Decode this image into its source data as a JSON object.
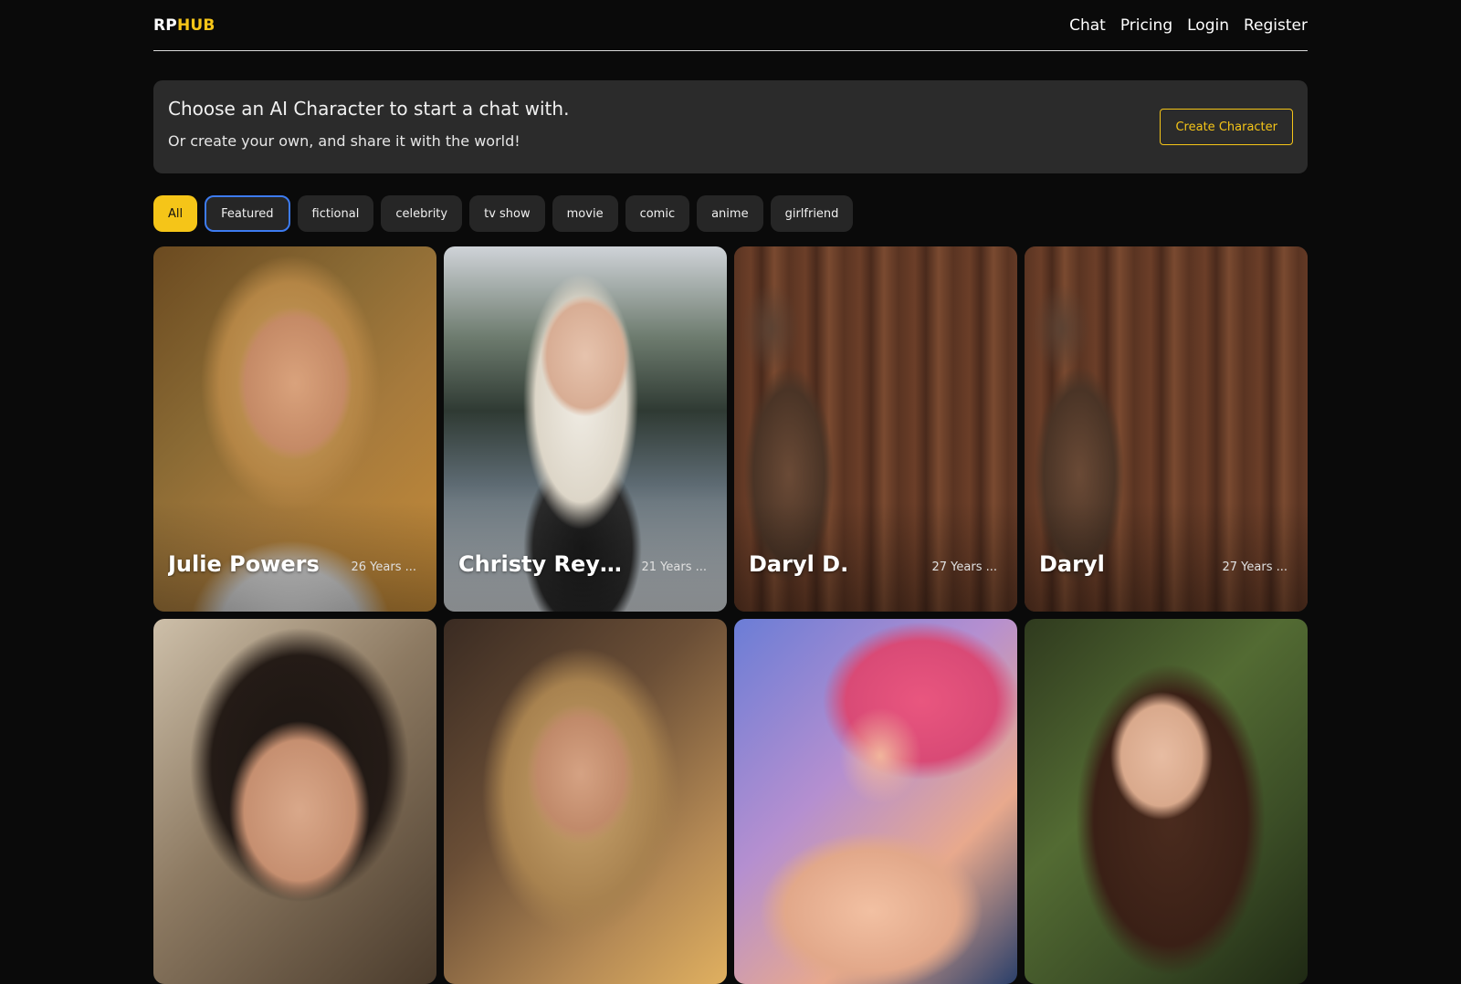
{
  "brand": {
    "part1": "RP",
    "part2": "HUB"
  },
  "nav": {
    "chat": "Chat",
    "pricing": "Pricing",
    "login": "Login",
    "register": "Register"
  },
  "hero": {
    "title": "Choose an AI Character to start a chat with.",
    "subtitle": "Or create your own, and share it with the world!",
    "create_button": "Create Character"
  },
  "filters": [
    "All",
    "Featured",
    "fictional",
    "celebrity",
    "tv show",
    "movie",
    "comic",
    "anime",
    "girlfriend"
  ],
  "active_filter": "All",
  "characters": [
    {
      "name": "Julie Powers",
      "age": "26 Years ..."
    },
    {
      "name": "Christy Reynol...",
      "age": "21 Years ..."
    },
    {
      "name": "Daryl D.",
      "age": "27 Years ..."
    },
    {
      "name": "Daryl",
      "age": "27 Years ..."
    },
    {
      "name": "",
      "age": ""
    },
    {
      "name": "",
      "age": ""
    },
    {
      "name": "",
      "age": ""
    },
    {
      "name": "",
      "age": ""
    }
  ],
  "colors": {
    "accent": "#f5c518",
    "background": "#0a0a0a",
    "hero_bg": "#2b2b2b",
    "chip_bg": "#262626",
    "focus_ring": "#3d7bf0"
  }
}
